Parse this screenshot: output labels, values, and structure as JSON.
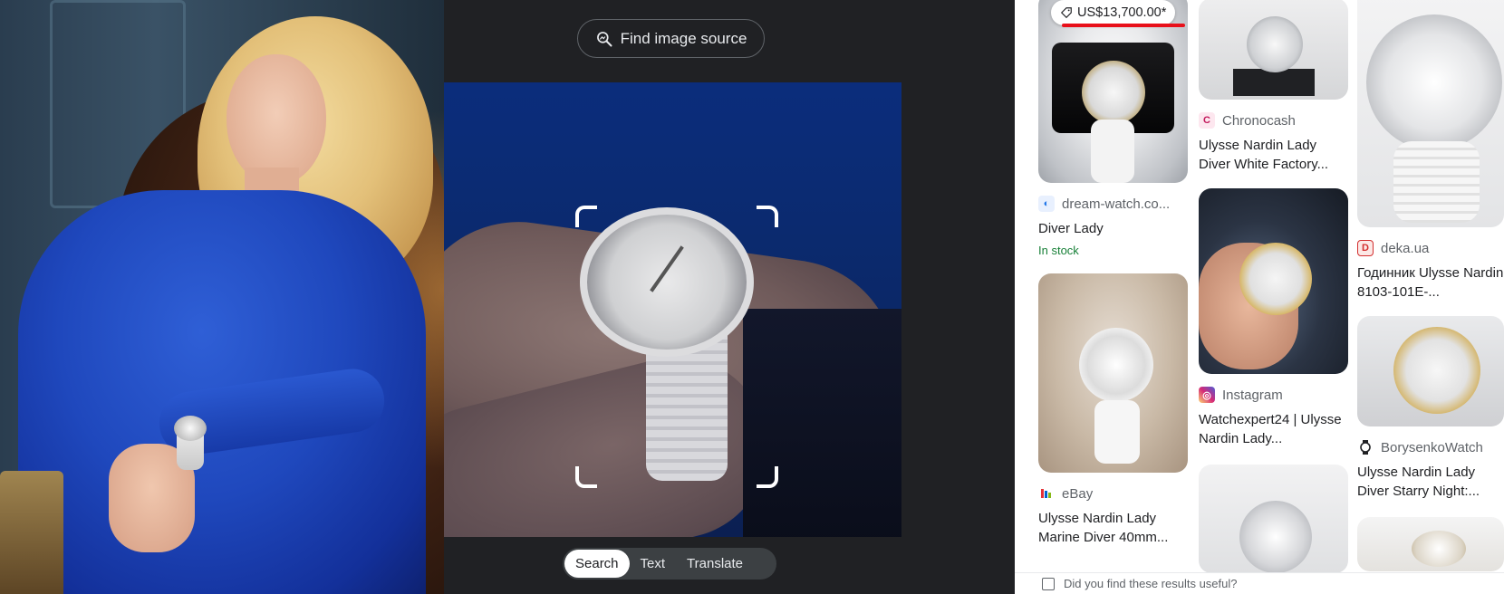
{
  "lens": {
    "find_source_label": "Find image source",
    "modes": [
      "Search",
      "Text",
      "Translate"
    ],
    "active_mode": "Search"
  },
  "results": {
    "col1": [
      {
        "price": "US$13,700.00*",
        "source": "dream-watch.co...",
        "title": "Diver Lady",
        "stock": "In stock",
        "icon_color": "#1a73e8"
      },
      {
        "source": "eBay",
        "title": "Ulysse Nardin Lady Marine Diver 40mm...",
        "icon_color": "#e53238"
      }
    ],
    "col2": [
      {
        "source": "Chronocash",
        "title": "Ulysse Nardin Lady Diver White Factory...",
        "icon_color": "#c2185b"
      },
      {
        "source": "Instagram",
        "title": "Watchexpert24 | Ulysse Nardin Lady...",
        "icon_color": "#d6249f"
      }
    ],
    "col3": [
      {
        "source": "deka.ua",
        "title": "Годинник Ulysse Nardin 8103-101E-...",
        "icon_color": "#d32f2f",
        "icon_letter": "D"
      },
      {
        "source": "BorysenkoWatch",
        "title": "Ulysse Nardin Lady Diver Starry Night:...",
        "icon_color": "#202124"
      }
    ],
    "feedback_text": "Did you find these results useful?"
  },
  "colors": {
    "lens_bg": "#202124",
    "price_underline": "#e8101a",
    "in_stock": "#188038"
  }
}
